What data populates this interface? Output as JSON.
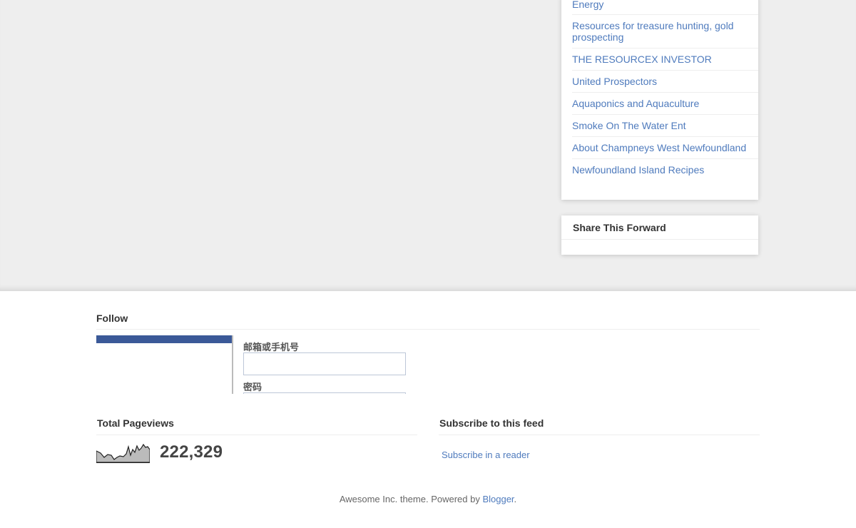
{
  "sidebar": {
    "links": [
      "Energy",
      "Resources for treasure hunting, gold prospecting",
      "THE RESOURCEX INVESTOR",
      "United Prospectors",
      "Aquaponics and Aquaculture",
      "Smoke On The Water Ent",
      "About Champneys West Newfoundland",
      "Newfoundland Island Recipes"
    ],
    "share_title": "Share This Forward"
  },
  "follow": {
    "title": "Follow",
    "email_label": "邮箱或手机号",
    "password_label": "密码"
  },
  "pageviews": {
    "title": "Total Pageviews",
    "count": "222,329"
  },
  "subscribe": {
    "title": "Subscribe to this feed",
    "link": "Subscribe in a reader"
  },
  "attribution": {
    "text": "Awesome Inc. theme. Powered by ",
    "link": "Blogger",
    "suffix": "."
  },
  "colors": {
    "background": "#eeeeee",
    "link": "#4f7bbd",
    "facebook": "#3b5998"
  }
}
